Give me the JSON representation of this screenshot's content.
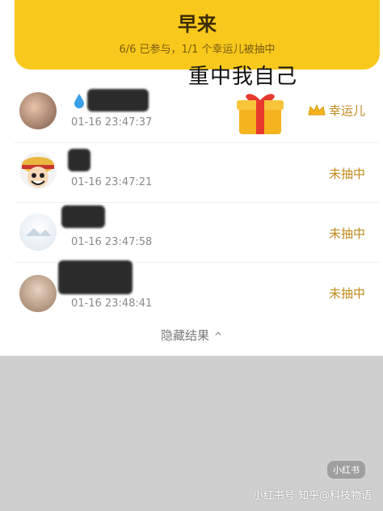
{
  "header": {
    "title": "早来",
    "subtitle": "6/6 已参与，1/1 个幸运儿被抽中"
  },
  "annotation": "重中我自己",
  "rows": [
    {
      "time": "01-16 23:47:37",
      "status": "幸运儿",
      "status_icon": "crown-icon"
    },
    {
      "time": "01-16 23:47:21",
      "status": "未抽中"
    },
    {
      "time": "01-16 23:47:58",
      "status": "未抽中"
    },
    {
      "time": "01-16 23:48:41",
      "status": "未抽中"
    }
  ],
  "toggle_label": "隐藏结果",
  "watermark": {
    "badge": "小红书",
    "text": "小红书号 知乎@科技物语"
  },
  "colors": {
    "header_bg": "#f8c81c",
    "status_text": "#c08a1e",
    "bottom_bg": "#cfcfcf"
  }
}
